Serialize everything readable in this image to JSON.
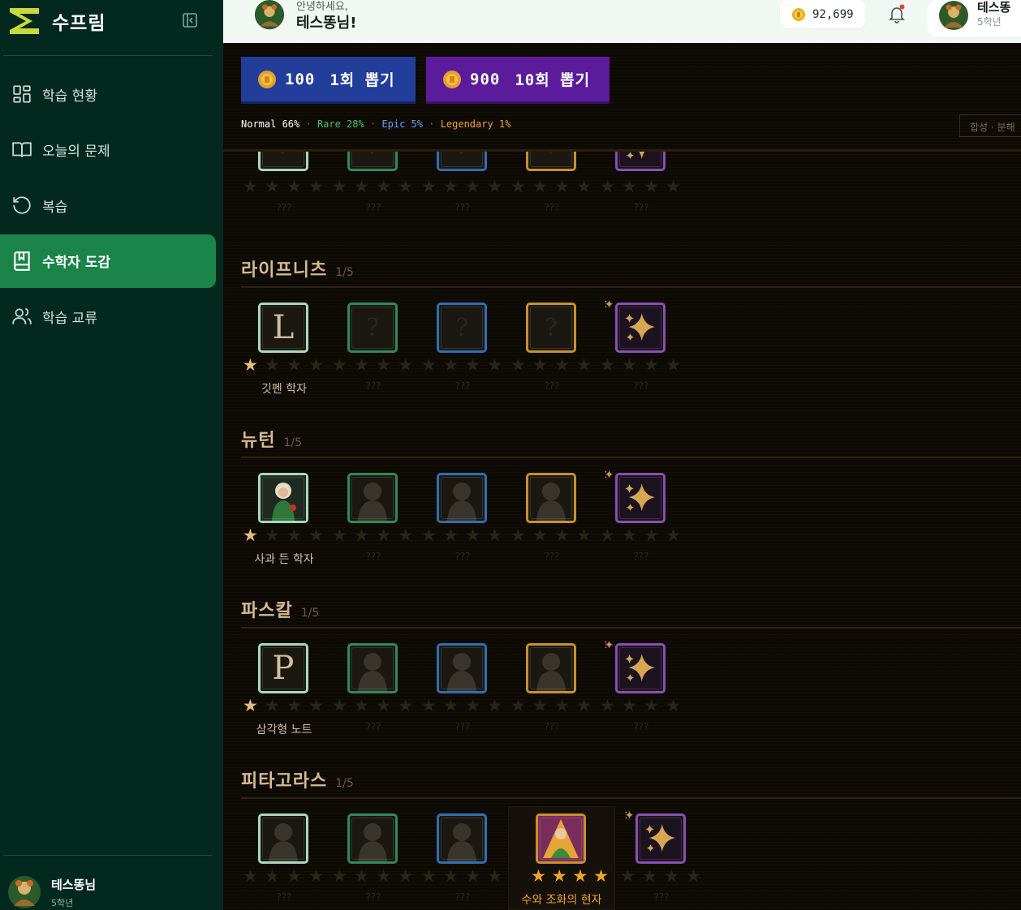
{
  "app": {
    "name": "수프림"
  },
  "sidebar": {
    "items": [
      {
        "label": "학습 현황",
        "icon": "dashboard-icon"
      },
      {
        "label": "오늘의 문제",
        "icon": "book-open-icon"
      },
      {
        "label": "복습",
        "icon": "rotate-ccw-icon"
      },
      {
        "label": "수학자 도감",
        "icon": "book-bookmark-icon",
        "active": true
      },
      {
        "label": "학습 교류",
        "icon": "users-icon"
      }
    ],
    "user": {
      "name": "테스똥님",
      "grade": "5학년"
    }
  },
  "header": {
    "greeting_small": "안녕하세요,",
    "greeting_big": "테스똥님!",
    "coins": "92,699",
    "profile": {
      "name": "테스똥",
      "grade": "5학년"
    }
  },
  "gacha": {
    "single": {
      "price": "100",
      "label": "1회 뽑기"
    },
    "multi": {
      "price": "900",
      "label": "10회 뽑기"
    },
    "rates": {
      "normal": "Normal 66%",
      "rare": "Rare 28%",
      "epic": "Epic 5%",
      "legendary": "Legendary 1%",
      "sep": " · "
    },
    "synth_label": "합성 · 분해"
  },
  "collection": {
    "hidden_name": "???",
    "sections": [
      {
        "title": "라이프니츠",
        "count": "1/5",
        "cards": [
          {
            "stars": 1,
            "name": "깃펜 학자",
            "glyph": "L",
            "owned": true
          },
          {
            "stars": 0,
            "name": "???"
          },
          {
            "stars": 0,
            "name": "???"
          },
          {
            "stars": 0,
            "name": "???"
          },
          {
            "stars": 0,
            "name": "???"
          }
        ]
      },
      {
        "title": "뉴턴",
        "count": "1/5",
        "cards": [
          {
            "stars": 1,
            "name": "사과 든 학자",
            "owned": true
          },
          {
            "stars": 0,
            "name": "???"
          },
          {
            "stars": 0,
            "name": "???"
          },
          {
            "stars": 0,
            "name": "???"
          },
          {
            "stars": 0,
            "name": "???"
          }
        ]
      },
      {
        "title": "파스칼",
        "count": "1/5",
        "cards": [
          {
            "stars": 1,
            "name": "삼각형 노트",
            "glyph": "P",
            "owned": true
          },
          {
            "stars": 0,
            "name": "???"
          },
          {
            "stars": 0,
            "name": "???"
          },
          {
            "stars": 0,
            "name": "???"
          },
          {
            "stars": 0,
            "name": "???"
          }
        ]
      },
      {
        "title": "피타고라스",
        "count": "1/5",
        "cards": [
          {
            "stars": 0,
            "name": "???"
          },
          {
            "stars": 0,
            "name": "???"
          },
          {
            "stars": 0,
            "name": "???"
          },
          {
            "stars": 4,
            "name": "수와 조화의 현자",
            "owned": true
          },
          {
            "stars": 0,
            "name": "???"
          }
        ]
      }
    ]
  },
  "colors": {
    "sidebar_bg": "#03291f",
    "active_nav": "#1a8449",
    "normal": "#a8d8bf",
    "rare": "#2e8a5c",
    "epic": "#2f6fb0",
    "legendary": "#c8902c",
    "mythic": "#8a4fb0"
  }
}
